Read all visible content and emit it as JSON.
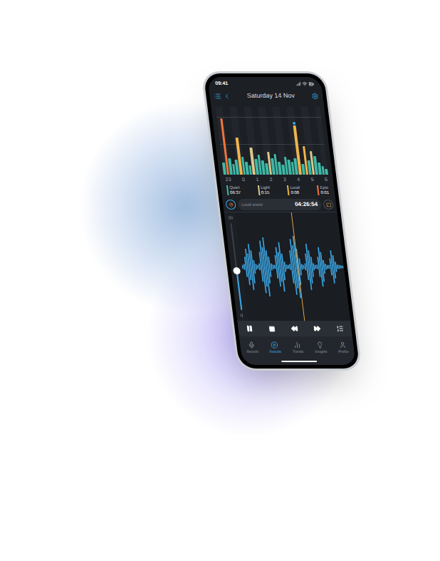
{
  "status_bar": {
    "time": "09:41"
  },
  "header": {
    "title": "Saturday 14 Nov"
  },
  "chart": {
    "x_ticks": [
      "23",
      "0",
      "1",
      "2",
      "3",
      "4",
      "5",
      "6"
    ],
    "max": 100,
    "selected_bar": 23,
    "series": [
      {
        "name": "Quiet",
        "color": "#3fb8a6",
        "values": [
          20,
          0,
          28,
          18,
          25,
          0,
          30,
          22,
          15,
          0,
          26,
          33,
          24,
          19,
          0,
          28,
          35,
          22,
          17,
          30,
          25,
          21,
          27,
          0,
          18,
          0,
          24,
          0,
          31,
          20,
          14,
          10
        ]
      },
      {
        "name": "Light",
        "color": "#d9c98a",
        "values": [
          0,
          0,
          0,
          0,
          0,
          0,
          0,
          0,
          0,
          45,
          0,
          0,
          0,
          0,
          38,
          0,
          0,
          0,
          0,
          0,
          0,
          0,
          0,
          0,
          0,
          0,
          0,
          40,
          0,
          0,
          0,
          0
        ]
      },
      {
        "name": "Loud",
        "color": "#f0b44c",
        "values": [
          0,
          0,
          0,
          0,
          0,
          62,
          0,
          0,
          0,
          0,
          0,
          0,
          0,
          0,
          0,
          0,
          0,
          0,
          0,
          0,
          0,
          0,
          0,
          82,
          0,
          48,
          0,
          0,
          0,
          0,
          0,
          0
        ]
      },
      {
        "name": "Epic",
        "color": "#f2753a",
        "values": [
          0,
          95,
          0,
          0,
          0,
          0,
          0,
          0,
          0,
          0,
          0,
          0,
          0,
          0,
          0,
          0,
          0,
          0,
          0,
          0,
          0,
          0,
          0,
          0,
          0,
          0,
          0,
          0,
          0,
          0,
          0,
          0
        ]
      }
    ]
  },
  "legend": [
    {
      "label": "Quiet",
      "value": "06:37",
      "color": "#3fb8a6"
    },
    {
      "label": "Light",
      "value": "0:15",
      "color": "#d9c98a"
    },
    {
      "label": "Loud",
      "value": "0:08",
      "color": "#f0b44c"
    },
    {
      "label": "Epic",
      "value": "0:01",
      "color": "#f2753a"
    }
  ],
  "event": {
    "label": "Loud snore",
    "time": "04:26:54"
  },
  "player": {
    "volume_level": 0.45,
    "playhead_level": 0.55,
    "waveform": [
      0.05,
      0.08,
      0.3,
      0.55,
      0.4,
      0.7,
      0.5,
      0.2,
      0.08,
      0.05,
      0.1,
      0.45,
      0.8,
      0.6,
      0.9,
      0.5,
      0.3,
      0.1,
      0.06,
      0.05,
      0.35,
      0.6,
      0.45,
      0.75,
      0.4,
      0.15,
      0.06,
      0.05,
      0.08,
      0.5,
      0.85,
      0.65,
      0.95,
      0.55,
      0.25,
      0.08,
      0.05,
      0.1,
      0.4,
      0.7,
      0.5,
      0.3,
      0.1,
      0.05,
      0.06,
      0.3,
      0.6,
      0.45,
      0.2,
      0.08,
      0.05,
      0.05,
      0.25,
      0.5,
      0.35,
      0.15,
      0.06,
      0.05,
      0.04,
      0.03
    ]
  },
  "nav": [
    {
      "label": "Record",
      "selected": false
    },
    {
      "label": "Results",
      "selected": true
    },
    {
      "label": "Trends",
      "selected": false
    },
    {
      "label": "Insights",
      "selected": false
    },
    {
      "label": "Profile",
      "selected": false
    }
  ]
}
